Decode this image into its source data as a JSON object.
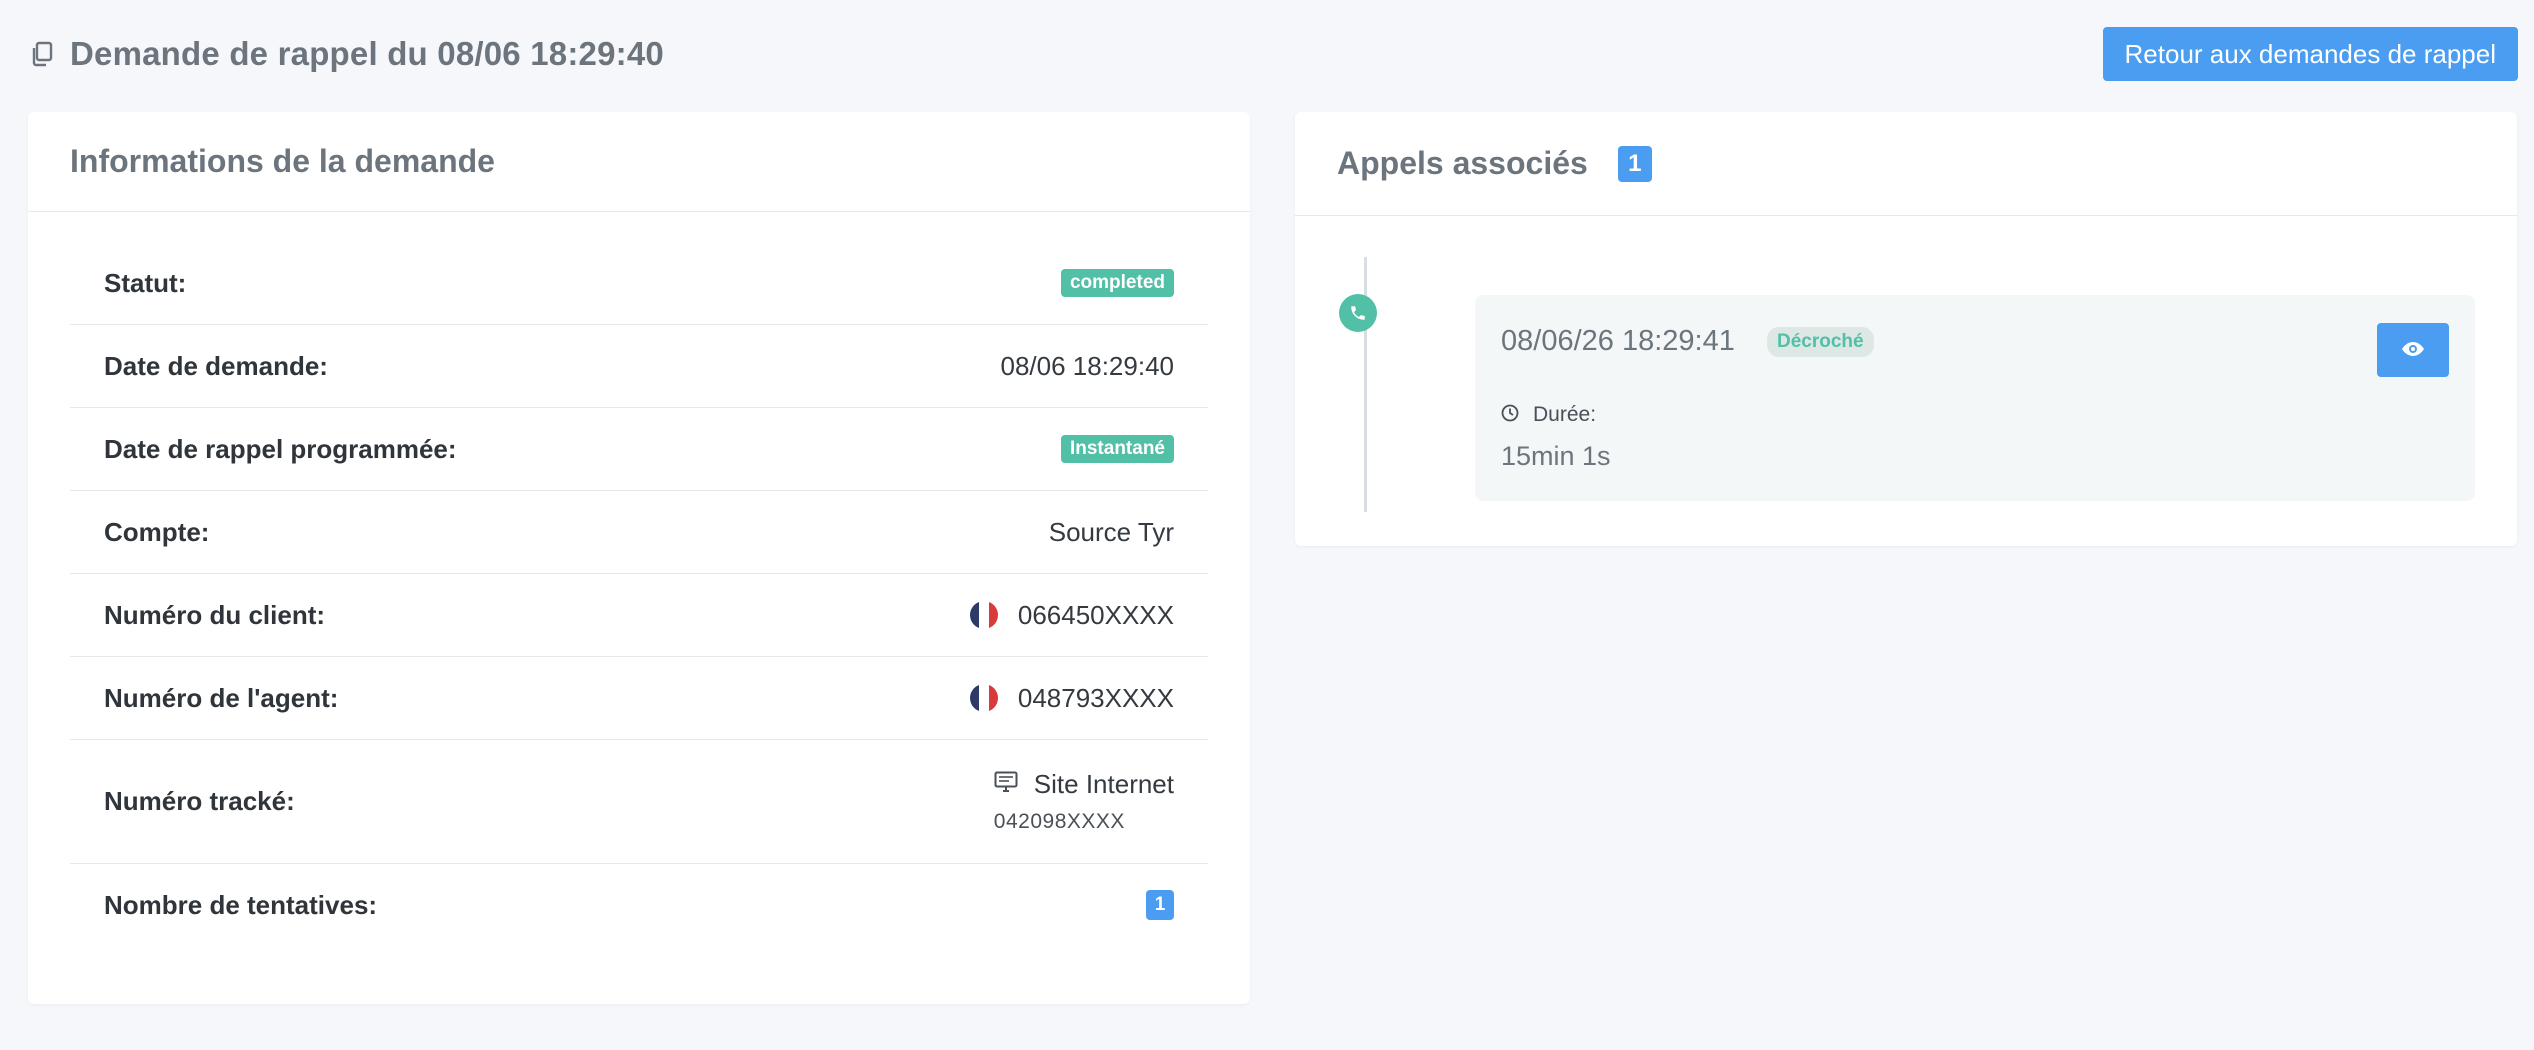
{
  "header": {
    "title": "Demande de rappel du 08/06 18:29:40",
    "back_button": "Retour aux demandes de rappel"
  },
  "info_card": {
    "title": "Informations de la demande",
    "rows": {
      "status": {
        "label": "Statut:",
        "value": "completed"
      },
      "request_date": {
        "label": "Date de demande:",
        "value": "08/06 18:29:40"
      },
      "scheduled_callback": {
        "label": "Date de rappel programmée:",
        "value": "Instantané"
      },
      "account": {
        "label": "Compte:",
        "value": "Source Tyr"
      },
      "client_number": {
        "label": "Numéro du client:",
        "value": "066450XXXX"
      },
      "agent_number": {
        "label": "Numéro de l'agent:",
        "value": "048793XXXX"
      },
      "tracked_number": {
        "label": "Numéro tracké:",
        "source": "Site Internet",
        "value": "042098XXXX"
      },
      "attempts": {
        "label": "Nombre de tentatives:",
        "value": "1"
      }
    }
  },
  "calls_card": {
    "title": "Appels associés",
    "count": "1",
    "calls": [
      {
        "datetime": "08/06/26 18:29:41",
        "status": "Décroché",
        "duration_label": "Durée:",
        "duration": "15min 1s"
      }
    ]
  },
  "colors": {
    "primary": "#4a9df0",
    "success": "#52bfa7",
    "flag_blue": "#2b3a67",
    "flag_red": "#d93a3a"
  },
  "icons": {
    "title_icon": "copy-icon",
    "flag": "france-flag-icon",
    "tracked_source": "monitor-icon",
    "timeline": "phone-icon",
    "duration": "clock-icon",
    "view": "eye-icon"
  }
}
